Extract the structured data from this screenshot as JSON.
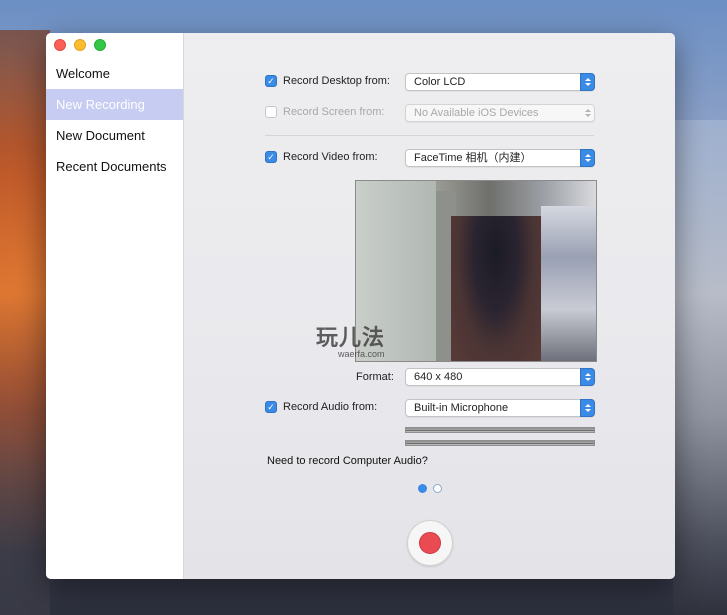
{
  "sidebar": {
    "items": [
      {
        "label": "Welcome"
      },
      {
        "label": "New Recording",
        "active": true
      },
      {
        "label": "New Document"
      },
      {
        "label": "Recent Documents"
      }
    ]
  },
  "recording": {
    "desktop": {
      "label": "Record Desktop from:",
      "checked": true,
      "value": "Color LCD"
    },
    "screen": {
      "label": "Record Screen from:",
      "checked": false,
      "value": "No Available iOS Devices"
    },
    "video": {
      "label": "Record Video from:",
      "checked": true,
      "value": "FaceTime 相机（内建）"
    },
    "format": {
      "label": "Format:",
      "value": "640 x 480"
    },
    "audio": {
      "label": "Record Audio from:",
      "checked": true,
      "value": "Built-in Microphone"
    },
    "computer_audio_link": "Need to record Computer Audio?"
  },
  "watermark": {
    "text": "玩儿法",
    "url": "waerfa.com"
  },
  "pagination": {
    "current": 1,
    "total": 2
  },
  "colors": {
    "accent": "#3a8be6",
    "record": "#ea4b52",
    "sidebar_active": "#c6ccf2"
  }
}
